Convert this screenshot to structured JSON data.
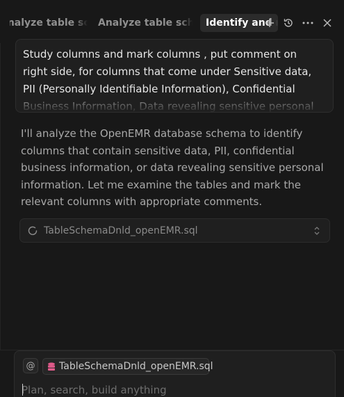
{
  "tabs": [
    {
      "label": "Analyze table schema",
      "active": false
    },
    {
      "label": "Analyze table schema",
      "active": false
    },
    {
      "label": "Identify and mark sensitive columns",
      "active": true
    }
  ],
  "tabbar_icons": [
    "plus-icon",
    "history-icon",
    "more-icon",
    "close-icon"
  ],
  "user_message": {
    "text": "Study columns and mark columns , put comment on right side, for columns that come under Sensitive data, PII (Personally Identifiable Information), Confidential Business Information, Data revealing sensitive personal"
  },
  "assistant_message": {
    "text": "I'll analyze the OpenEMR database schema to identify columns that contain sensitive data, PII, confidential business information, or data revealing sensitive personal information. Let me examine the tables and mark the relevant columns with appropriate comments."
  },
  "file_reference": {
    "name": "TableSchemaDnld_openEMR.sql",
    "status_icon": "loading-spinner-icon"
  },
  "composer": {
    "mention_label": "@",
    "context_file": "TableSchemaDnld_openEMR.sql",
    "context_icon": "database-icon",
    "placeholder": "Plan, search, build anything"
  },
  "colors": {
    "background": "#181818",
    "panel": "#1f1f1f",
    "active_tab": "#2b2b2b",
    "database_icon": "#e05a8a"
  }
}
